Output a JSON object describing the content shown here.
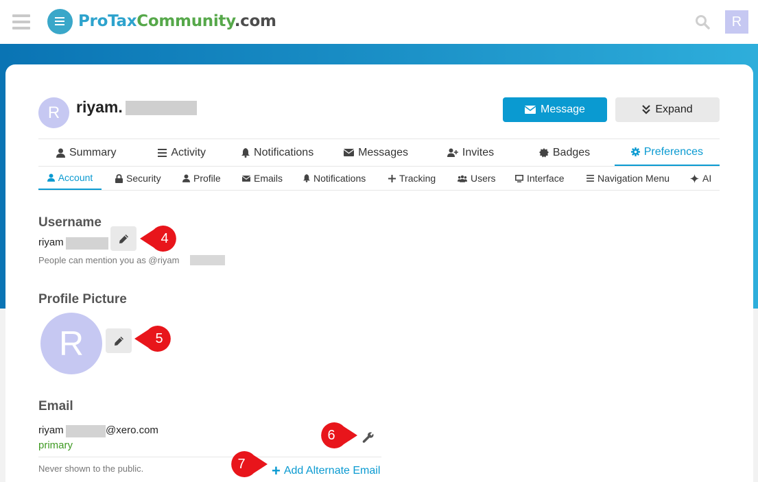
{
  "header": {
    "logo_pro": "ProTax",
    "logo_community": "Community",
    "logo_domain": ".com",
    "user_initial": "R"
  },
  "profile": {
    "initial": "R",
    "name": "riyam.",
    "message_label": "Message",
    "expand_label": "Expand"
  },
  "main_tabs": [
    {
      "label": "Summary",
      "icon": "user-icon"
    },
    {
      "label": "Activity",
      "icon": "list-icon"
    },
    {
      "label": "Notifications",
      "icon": "bell-icon"
    },
    {
      "label": "Messages",
      "icon": "envelope-icon"
    },
    {
      "label": "Invites",
      "icon": "user-plus-icon"
    },
    {
      "label": "Badges",
      "icon": "badge-icon"
    },
    {
      "label": "Preferences",
      "icon": "gear-icon",
      "active": true
    }
  ],
  "sub_tabs": [
    {
      "label": "Account",
      "icon": "user-icon",
      "active": true
    },
    {
      "label": "Security",
      "icon": "lock-icon"
    },
    {
      "label": "Profile",
      "icon": "user-icon"
    },
    {
      "label": "Emails",
      "icon": "envelope-icon"
    },
    {
      "label": "Notifications",
      "icon": "bell-icon"
    },
    {
      "label": "Tracking",
      "icon": "plus-icon"
    },
    {
      "label": "Users",
      "icon": "users-icon"
    },
    {
      "label": "Interface",
      "icon": "monitor-icon"
    },
    {
      "label": "Navigation Menu",
      "icon": "list-icon"
    },
    {
      "label": "AI",
      "icon": "sparkle-icon"
    }
  ],
  "username": {
    "title": "Username",
    "value": "riyam",
    "hint": "People can mention you as @riyam"
  },
  "profile_picture": {
    "title": "Profile Picture",
    "initial": "R"
  },
  "email": {
    "title": "Email",
    "value_prefix": "riyam",
    "value_suffix": "@xero.com",
    "primary_label": "primary",
    "hint": "Never shown to the public.",
    "add_alternate_label": "Add Alternate Email"
  },
  "callouts": [
    "4",
    "5",
    "6",
    "7"
  ],
  "colors": {
    "accent": "#0a9ad1",
    "callout_red": "#e8151b",
    "avatar": "#c6c8f2",
    "primary_green": "#3f9a23"
  }
}
